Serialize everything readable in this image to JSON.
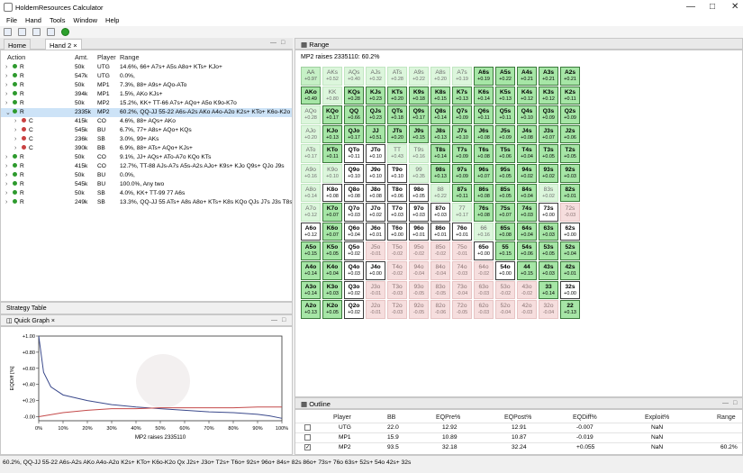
{
  "window": {
    "title": "HoldemResources Calculator"
  },
  "menu": [
    "File",
    "Hand",
    "Tools",
    "Window",
    "Help"
  ],
  "left_tabs": [
    {
      "label": "Home"
    },
    {
      "label": "Hand 2"
    }
  ],
  "action_table": {
    "headers": [
      "Action",
      "Amt.",
      "Player",
      "Range"
    ],
    "rows": [
      {
        "action": "R",
        "amt": "50k",
        "player": "UTG",
        "range": "14.6%, 66+ A7s+ A5s A8o+ KTs+ KJo+",
        "color": "g",
        "indent": 0
      },
      {
        "action": "R",
        "amt": "547k",
        "player": "UTG",
        "range": "0.0%,",
        "color": "g",
        "indent": 0
      },
      {
        "action": "R",
        "amt": "50k",
        "player": "MP1",
        "range": "7.3%, 88+ A9s+ AQo-ATo",
        "color": "g",
        "indent": 0
      },
      {
        "action": "R",
        "amt": "394k",
        "player": "MP1",
        "range": "1.5%, AKo KJs+",
        "color": "g",
        "indent": 0
      },
      {
        "action": "R",
        "amt": "50k",
        "player": "MP2",
        "range": "15.2%, KK+ TT-66 A7s+ AQo+ A5o K9o-K7o",
        "color": "g",
        "indent": 0
      },
      {
        "action": "R",
        "amt": "2335k",
        "player": "MP2",
        "range": "60.2%, QQ-JJ 55-22 A6s-A2s AKo A4o-A2o K2s+ KTo+ K6o-K2o",
        "color": "g",
        "indent": 0,
        "selected": true
      },
      {
        "action": "C",
        "amt": "415k",
        "player": "CO",
        "range": "4.6%, 88+ AQs+ AKo",
        "color": "r",
        "indent": 1
      },
      {
        "action": "C",
        "amt": "545k",
        "player": "BU",
        "range": "6.7%, 77+ A8s+ AQo+ KQs",
        "color": "r",
        "indent": 1
      },
      {
        "action": "C",
        "amt": "236k",
        "player": "SB",
        "range": "3.0%, 99+ AKs",
        "color": "r",
        "indent": 1
      },
      {
        "action": "C",
        "amt": "390k",
        "player": "BB",
        "range": "6.9%, 88+ ATs+ AQo+ KJs+",
        "color": "r",
        "indent": 1
      },
      {
        "action": "R",
        "amt": "50k",
        "player": "CO",
        "range": "9.1%, JJ+ AQs+ ATo-A7o KQo KTs",
        "color": "g",
        "indent": 0
      },
      {
        "action": "R",
        "amt": "415k",
        "player": "CO",
        "range": "12.7%, TT-88 AJs-A7s A5s-A2s AJo+ K9s+ KJo Q9s+ QJo J9s",
        "color": "g",
        "indent": 0
      },
      {
        "action": "R",
        "amt": "50k",
        "player": "BU",
        "range": "0.0%,",
        "color": "g",
        "indent": 0
      },
      {
        "action": "R",
        "amt": "545k",
        "player": "BU",
        "range": "100.0%, Any two",
        "color": "g",
        "indent": 0
      },
      {
        "action": "R",
        "amt": "50k",
        "player": "SB",
        "range": "4.0%, KK+ TT-99 77 A6s",
        "color": "g",
        "indent": 0
      },
      {
        "action": "R",
        "amt": "249k",
        "player": "SB",
        "range": "13.3%, QQ-JJ 55 ATs+ A8s A8o+ KTs+ K8s KQo QJs J7s J3s T8s",
        "color": "g",
        "indent": 0
      }
    ]
  },
  "strategy_table_label": "Strategy Table",
  "quick_graph": {
    "tab_label": "Quick Graph",
    "ylabel": "EQDiff [%]",
    "xlabel": "MP2 raises 2335110",
    "y_ticks": [
      "+1.00",
      "+0.80",
      "+0.60",
      "+0.40",
      "+0.20",
      "-0.00"
    ],
    "x_ticks": [
      "0%",
      "10%",
      "20%",
      "30%",
      "40%",
      "50%",
      "60%",
      "70%",
      "80%",
      "90%",
      "100%"
    ],
    "chart_data": {
      "type": "line",
      "series": [
        {
          "x": [
            0,
            2,
            5,
            10,
            20,
            30,
            40,
            50,
            60,
            70,
            80,
            90,
            95,
            100
          ],
          "values": [
            1.0,
            0.55,
            0.37,
            0.27,
            0.2,
            0.15,
            0.12,
            0.1,
            0.08,
            0.06,
            0.05,
            0.03,
            0.01,
            -0.02
          ]
        },
        {
          "x": [
            0,
            10,
            20,
            30,
            40,
            50,
            60,
            70,
            80,
            90,
            100
          ],
          "values": [
            0.0,
            0.05,
            0.08,
            0.1,
            0.1,
            0.11,
            0.11,
            0.11,
            0.11,
            0.12,
            0.12
          ]
        }
      ],
      "ylim": [
        -0.05,
        1.0
      ]
    }
  },
  "range_panel": {
    "tab_label": "Range",
    "header": "MP2 raises 2335110: 60.2%",
    "rows": [
      [
        [
          "AA",
          "+0.97",
          "lg"
        ],
        [
          "AKs",
          "+0.52",
          "fg"
        ],
        [
          "AQs",
          "+0.40",
          "fg"
        ],
        [
          "AJs",
          "+0.32",
          "fg"
        ],
        [
          "ATs",
          "+0.28",
          "fg"
        ],
        [
          "A9s",
          "+0.22",
          "fg"
        ],
        [
          "A8s",
          "+0.20",
          "fg"
        ],
        [
          "A7s",
          "+0.19",
          "fg"
        ],
        [
          "A6s",
          "+0.19",
          "g"
        ],
        [
          "A5s",
          "+0.22",
          "g"
        ],
        [
          "A4s",
          "+0.21",
          "g"
        ],
        [
          "A3s",
          "+0.21",
          "g"
        ],
        [
          "A2s",
          "+0.21",
          "g"
        ]
      ],
      [
        [
          "AKo",
          "+0.49",
          "g"
        ],
        [
          "KK",
          "+0.80",
          "fg"
        ],
        [
          "KQs",
          "+0.28",
          "g"
        ],
        [
          "KJs",
          "+0.23",
          "g"
        ],
        [
          "KTs",
          "+0.20",
          "g"
        ],
        [
          "K9s",
          "+0.18",
          "g"
        ],
        [
          "K8s",
          "+0.15",
          "g"
        ],
        [
          "K7s",
          "+0.13",
          "g"
        ],
        [
          "K6s",
          "+0.14",
          "g"
        ],
        [
          "K5s",
          "+0.13",
          "g"
        ],
        [
          "K4s",
          "+0.12",
          "g"
        ],
        [
          "K3s",
          "+0.12",
          "g"
        ],
        [
          "K2s",
          "+0.11",
          "g"
        ]
      ],
      [
        [
          "AQo",
          "+0.28",
          "fg"
        ],
        [
          "KQo",
          "+0.17",
          "g"
        ],
        [
          "QQ",
          "+0.66",
          "g"
        ],
        [
          "QJs",
          "+0.23",
          "g"
        ],
        [
          "QTs",
          "+0.18",
          "g"
        ],
        [
          "Q9s",
          "+0.17",
          "g"
        ],
        [
          "Q8s",
          "+0.14",
          "g"
        ],
        [
          "Q7s",
          "+0.09",
          "g"
        ],
        [
          "Q6s",
          "+0.11",
          "g"
        ],
        [
          "Q5s",
          "+0.11",
          "g"
        ],
        [
          "Q4s",
          "+0.10",
          "g"
        ],
        [
          "Q3s",
          "+0.09",
          "g"
        ],
        [
          "Q2s",
          "+0.09",
          "g"
        ]
      ],
      [
        [
          "AJo",
          "+0.20",
          "fg"
        ],
        [
          "KJo",
          "+0.13",
          "g"
        ],
        [
          "QJo",
          "+0.17",
          "g"
        ],
        [
          "JJ",
          "+0.51",
          "g"
        ],
        [
          "JTs",
          "+0.20",
          "g"
        ],
        [
          "J9s",
          "+0.15",
          "g"
        ],
        [
          "J8s",
          "+0.13",
          "g"
        ],
        [
          "J7s",
          "+0.10",
          "g"
        ],
        [
          "J6s",
          "+0.08",
          "g"
        ],
        [
          "J5s",
          "+0.09",
          "g"
        ],
        [
          "J4s",
          "+0.08",
          "g"
        ],
        [
          "J3s",
          "+0.07",
          "g"
        ],
        [
          "J2s",
          "+0.06",
          "g"
        ]
      ],
      [
        [
          "ATo",
          "+0.17",
          "fg"
        ],
        [
          "KTo",
          "+0.11",
          "g"
        ],
        [
          "QTo",
          "+0.11",
          "w"
        ],
        [
          "JTo",
          "+0.10",
          "w"
        ],
        [
          "TT",
          "+0.43",
          "fg"
        ],
        [
          "T9s",
          "+0.16",
          "fg"
        ],
        [
          "T8s",
          "+0.14",
          "g"
        ],
        [
          "T7s",
          "+0.09",
          "g"
        ],
        [
          "T6s",
          "+0.08",
          "g"
        ],
        [
          "T5s",
          "+0.06",
          "g"
        ],
        [
          "T4s",
          "+0.04",
          "g"
        ],
        [
          "T3s",
          "+0.05",
          "g"
        ],
        [
          "T2s",
          "+0.05",
          "g"
        ]
      ],
      [
        [
          "A9o",
          "+0.16",
          "fg"
        ],
        [
          "K9o",
          "+0.10",
          "fg"
        ],
        [
          "Q9o",
          "+0.10",
          "w"
        ],
        [
          "J9o",
          "+0.10",
          "w"
        ],
        [
          "T9o",
          "+0.10",
          "w"
        ],
        [
          "99",
          "+0.35",
          "fg"
        ],
        [
          "98s",
          "+0.13",
          "g"
        ],
        [
          "97s",
          "+0.09",
          "g"
        ],
        [
          "96s",
          "+0.07",
          "g"
        ],
        [
          "95s",
          "+0.05",
          "g"
        ],
        [
          "94s",
          "+0.02",
          "g"
        ],
        [
          "93s",
          "+0.02",
          "g"
        ],
        [
          "92s",
          "+0.03",
          "g"
        ]
      ],
      [
        [
          "A8o",
          "+0.14",
          "fg"
        ],
        [
          "K8o",
          "+0.08",
          "w"
        ],
        [
          "Q8o",
          "+0.08",
          "w"
        ],
        [
          "J8o",
          "+0.08",
          "w"
        ],
        [
          "T8o",
          "+0.06",
          "w"
        ],
        [
          "98o",
          "+0.05",
          "w"
        ],
        [
          "88",
          "+0.22",
          "fg"
        ],
        [
          "87s",
          "+0.11",
          "g"
        ],
        [
          "86s",
          "+0.08",
          "g"
        ],
        [
          "85s",
          "+0.05",
          "g"
        ],
        [
          "84s",
          "+0.04",
          "g"
        ],
        [
          "83s",
          "+0.02",
          "fg"
        ],
        [
          "82s",
          "+0.01",
          "g"
        ]
      ],
      [
        [
          "A7o",
          "+0.12",
          "fg"
        ],
        [
          "K7o",
          "+0.07",
          "g"
        ],
        [
          "Q7o",
          "+0.03",
          "w"
        ],
        [
          "J7o",
          "+0.02",
          "w"
        ],
        [
          "T7o",
          "+0.03",
          "w"
        ],
        [
          "97o",
          "+0.03",
          "w"
        ],
        [
          "87o",
          "+0.03",
          "w"
        ],
        [
          "77",
          "+0.17",
          "fg"
        ],
        [
          "76s",
          "+0.08",
          "g"
        ],
        [
          "75s",
          "+0.07",
          "g"
        ],
        [
          "74s",
          "+0.03",
          "g"
        ],
        [
          "73s",
          "+0.00",
          "w"
        ],
        [
          "72s",
          "-0.03",
          "pk"
        ]
      ],
      [
        [
          "A6o",
          "+0.12",
          "w"
        ],
        [
          "K6o",
          "+0.07",
          "g"
        ],
        [
          "Q6o",
          "+0.04",
          "w"
        ],
        [
          "J6o",
          "+0.01",
          "w"
        ],
        [
          "T6o",
          "+0.00",
          "w"
        ],
        [
          "96o",
          "+0.01",
          "w"
        ],
        [
          "86o",
          "+0.01",
          "w"
        ],
        [
          "76o",
          "+0.01",
          "w"
        ],
        [
          "66",
          "+0.16",
          "fg"
        ],
        [
          "65s",
          "+0.08",
          "g"
        ],
        [
          "64s",
          "+0.04",
          "g"
        ],
        [
          "63s",
          "+0.03",
          "g"
        ],
        [
          "62s",
          "+0.00",
          "w"
        ]
      ],
      [
        [
          "A5o",
          "+0.15",
          "g"
        ],
        [
          "K5o",
          "+0.05",
          "g"
        ],
        [
          "Q5o",
          "+0.02",
          "w"
        ],
        [
          "J5o",
          "-0.01",
          "pk"
        ],
        [
          "T5o",
          "-0.02",
          "pk"
        ],
        [
          "95o",
          "-0.02",
          "pk"
        ],
        [
          "85o",
          "-0.02",
          "pk"
        ],
        [
          "75o",
          "-0.01",
          "pk"
        ],
        [
          "65o",
          "+0.00",
          "w"
        ],
        [
          "55",
          "+0.15",
          "g"
        ],
        [
          "54s",
          "+0.06",
          "g"
        ],
        [
          "53s",
          "+0.05",
          "g"
        ],
        [
          "52s",
          "+0.04",
          "g"
        ]
      ],
      [
        [
          "A4o",
          "+0.14",
          "g"
        ],
        [
          "K4o",
          "+0.04",
          "g"
        ],
        [
          "Q4o",
          "+0.03",
          "w"
        ],
        [
          "J4o",
          "+0.00",
          "w"
        ],
        [
          "T4o",
          "-0.02",
          "pk"
        ],
        [
          "94o",
          "-0.04",
          "pk"
        ],
        [
          "84o",
          "-0.04",
          "pk"
        ],
        [
          "74o",
          "-0.03",
          "pk"
        ],
        [
          "64o",
          "-0.02",
          "pk"
        ],
        [
          "54o",
          "+0.00",
          "w"
        ],
        [
          "44",
          "+0.15",
          "g"
        ],
        [
          "43s",
          "+0.03",
          "g"
        ],
        [
          "42s",
          "+0.01",
          "g"
        ]
      ],
      [
        [
          "A3o",
          "+0.14",
          "g"
        ],
        [
          "K3o",
          "+0.03",
          "g"
        ],
        [
          "Q3o",
          "+0.02",
          "w"
        ],
        [
          "J3o",
          "-0.01",
          "pk"
        ],
        [
          "T3o",
          "-0.03",
          "pk"
        ],
        [
          "93o",
          "-0.05",
          "pk"
        ],
        [
          "83o",
          "-0.05",
          "pk"
        ],
        [
          "73o",
          "-0.04",
          "pk"
        ],
        [
          "63o",
          "-0.03",
          "pk"
        ],
        [
          "53o",
          "-0.02",
          "pk"
        ],
        [
          "43o",
          "-0.02",
          "pk"
        ],
        [
          "33",
          "+0.14",
          "g"
        ],
        [
          "32s",
          "+0.00",
          "w"
        ]
      ],
      [
        [
          "A2o",
          "+0.13",
          "g"
        ],
        [
          "K2o",
          "+0.05",
          "g"
        ],
        [
          "Q2o",
          "+0.02",
          "w"
        ],
        [
          "J2o",
          "-0.01",
          "pk"
        ],
        [
          "T2o",
          "-0.03",
          "pk"
        ],
        [
          "92o",
          "-0.05",
          "pk"
        ],
        [
          "82o",
          "-0.06",
          "pk"
        ],
        [
          "72o",
          "-0.05",
          "pk"
        ],
        [
          "62o",
          "-0.03",
          "pk"
        ],
        [
          "52o",
          "-0.04",
          "pk"
        ],
        [
          "42o",
          "-0.03",
          "pk"
        ],
        [
          "32o",
          "-0.04",
          "pk"
        ],
        [
          "22",
          "+0.13",
          "g"
        ]
      ]
    ]
  },
  "outline": {
    "tab_label": "Outline",
    "headers": [
      "Player",
      "BB",
      "EQPre%",
      "EQPost%",
      "EQDiff%",
      "Exploit%",
      "Range"
    ],
    "rows": [
      {
        "checked": false,
        "player": "UTG",
        "bb": "22.0",
        "eqpre": "12.92",
        "eqpost": "12.91",
        "eqdiff": "-0.007",
        "exploit": "NaN",
        "range": ""
      },
      {
        "checked": false,
        "player": "MP1",
        "bb": "15.9",
        "eqpre": "10.89",
        "eqpost": "10.87",
        "eqdiff": "-0.019",
        "exploit": "NaN",
        "range": ""
      },
      {
        "checked": true,
        "player": "MP2",
        "bb": "93.5",
        "eqpre": "32.18",
        "eqpost": "32.24",
        "eqdiff": "+0.055",
        "exploit": "NaN",
        "range": "60.2%"
      }
    ]
  },
  "status": "60.2%, QQ-JJ 55-22 A6s-A2s AKo A4o-A2o K2s+ KTo+ K6o-K2o Qx J2s+ J3o+ T2s+ T6o+ 92s+ 96o+ 84s+ 82s 86o+ 73s+ 76o 63s+ 52s+ 54o 42s+ 32s",
  "colors": {
    "green_cell": "#a6e6a6",
    "pink_cell": "#f6dede",
    "selection": "#cde3f7",
    "line_blue": "#3b4a8c",
    "line_red": "#c44a4a"
  }
}
